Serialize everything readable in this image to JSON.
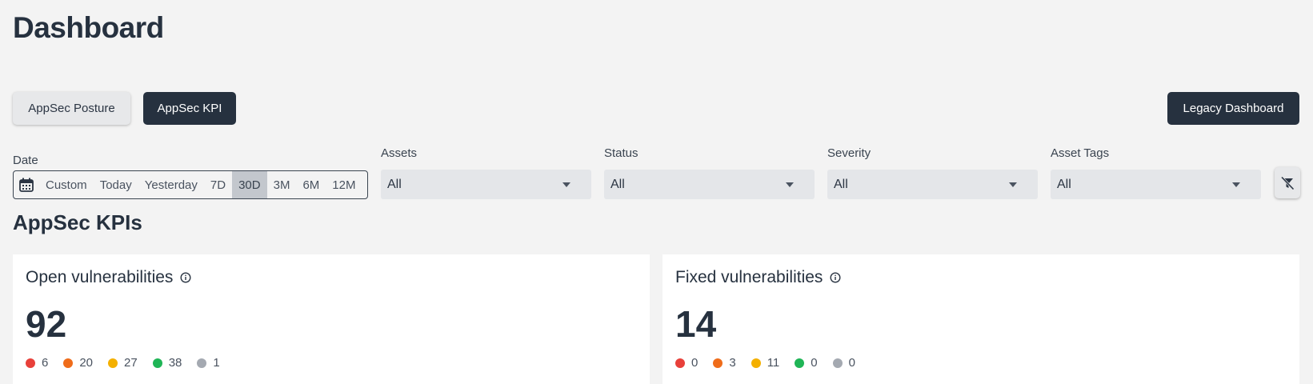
{
  "page": {
    "title": "Dashboard"
  },
  "tabs": {
    "posture": "AppSec Posture",
    "kpi": "AppSec KPI"
  },
  "header": {
    "legacy_label": "Legacy Dashboard"
  },
  "filters": {
    "date": {
      "label": "Date",
      "options": [
        "Custom",
        "Today",
        "Yesterday",
        "7D",
        "30D",
        "3M",
        "6M",
        "12M"
      ],
      "selected": "30D"
    },
    "assets": {
      "label": "Assets",
      "value": "All"
    },
    "status": {
      "label": "Status",
      "value": "All"
    },
    "severity": {
      "label": "Severity",
      "value": "All"
    },
    "asset_tags": {
      "label": "Asset Tags",
      "value": "All"
    }
  },
  "section": {
    "title": "AppSec KPIs"
  },
  "severity_colors": {
    "critical": "#e8403a",
    "high": "#ef6c1a",
    "medium": "#f4b000",
    "low": "#1fb556",
    "info": "#a4a9b1"
  },
  "cards": {
    "open": {
      "title": "Open vulnerabilities",
      "value": "92",
      "counts": [
        "6",
        "20",
        "27",
        "38",
        "1"
      ]
    },
    "fixed": {
      "title": "Fixed vulnerabilities",
      "value": "14",
      "counts": [
        "0",
        "3",
        "11",
        "0",
        "0"
      ]
    }
  }
}
